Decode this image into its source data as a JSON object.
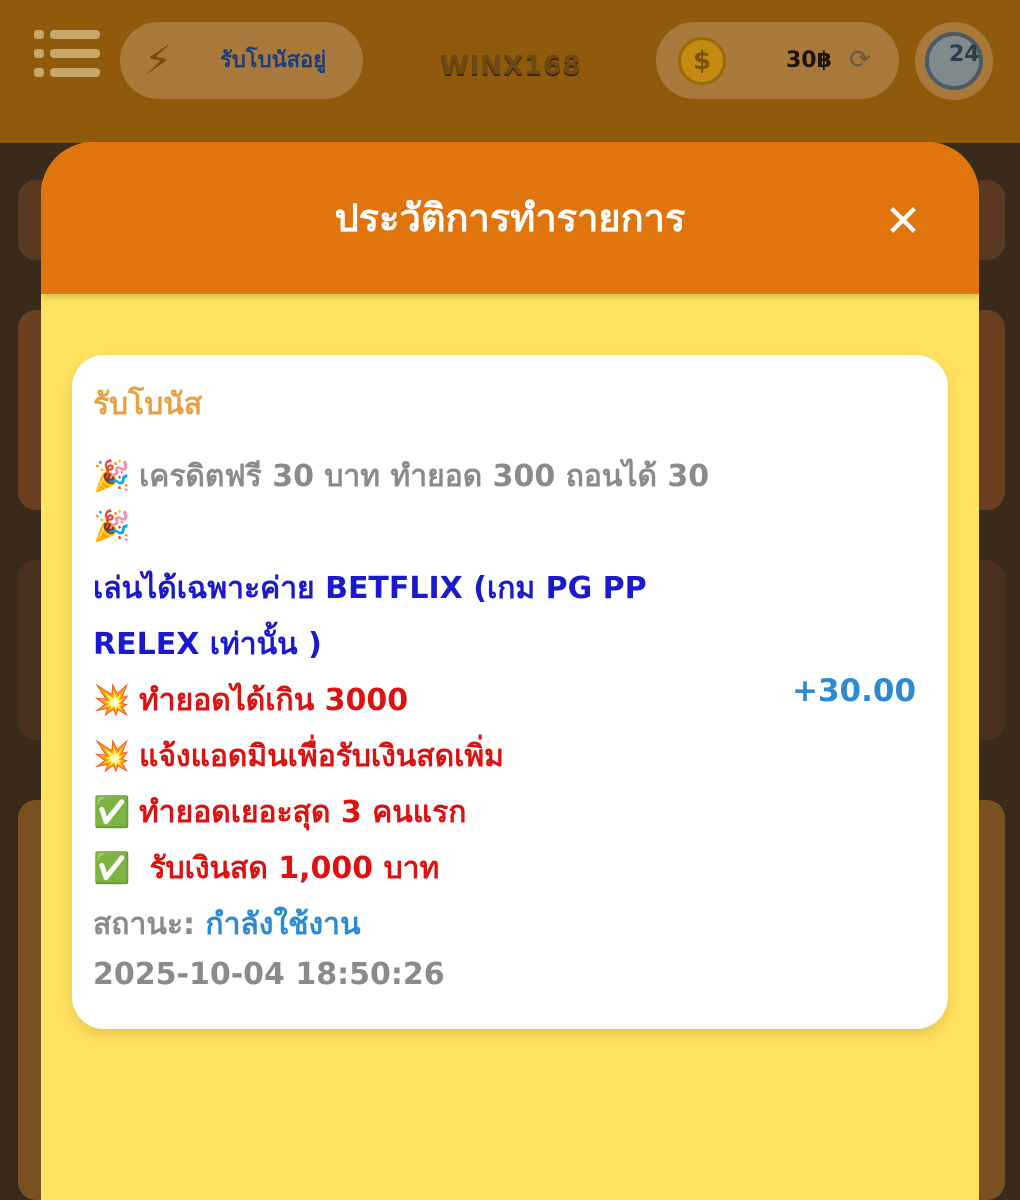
{
  "topbar": {
    "bonus_label": "รับโบนัสอยู่",
    "logo_text": "WINX168",
    "credit_amount": "30฿",
    "support_label": "24"
  },
  "modal": {
    "title": "ประวัติการทำรายการ",
    "transaction": {
      "type": "รับโบนัส",
      "lines": [
        {
          "emoji": "🎉",
          "text": "เครดิตฟรี 30 บาท ทำยอด 300 ถอนได้ 30"
        },
        {
          "emoji": "🎉",
          "text": ""
        },
        {
          "emoji": "",
          "text": "เล่นได้เฉพาะค่าย BETFLIX (เกม PG PP"
        },
        {
          "emoji": "",
          "text": "RELEX เท่านั้น )"
        },
        {
          "emoji": "💥",
          "text": "ทำยอดได้เกิน 3000"
        },
        {
          "emoji": "💥",
          "text": "แจ้งแอดมินเพื่อรับเงินสดเพิ่ม"
        },
        {
          "emoji": "✅",
          "text": "ทำยอดเยอะสุด 3 คนแรก"
        },
        {
          "emoji": "✅",
          "text": " รับเงินสด 1,000 บาท"
        }
      ],
      "status_label": "สถานะ:",
      "status_value": "กำลังใช้งาน",
      "timestamp": "2025-10-04 18:50:26",
      "amount": "+30.00"
    }
  },
  "colors": {
    "header_orange": "#e0750e",
    "modal_yellow": "#ffe360",
    "amount_blue": "#2a8ad4"
  },
  "icons": [
    "menu-icon",
    "bolt-icon",
    "coin-icon",
    "refresh-icon",
    "support-24-icon",
    "close-icon"
  ]
}
